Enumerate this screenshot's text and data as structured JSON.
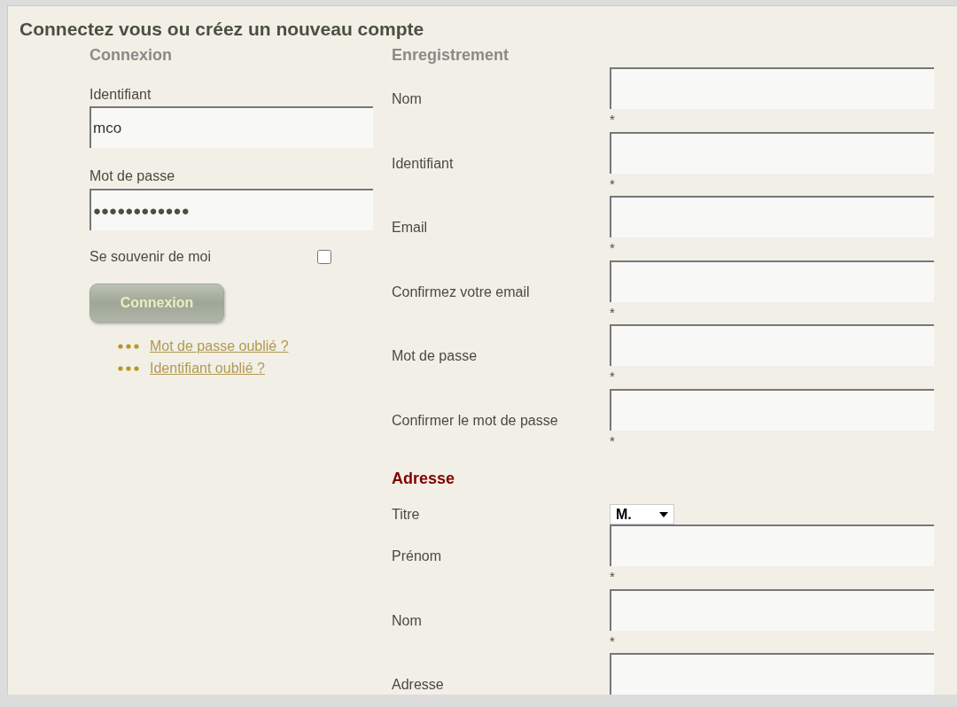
{
  "page": {
    "title": "Connectez vous ou créez un nouveau compte"
  },
  "login": {
    "heading": "Connexion",
    "fields": [
      {
        "label": "Identifiant",
        "value": "mco"
      },
      {
        "label": "Mot de passe",
        "value": "●●●●●●●●●●●●"
      }
    ],
    "remember": {
      "label": "Se souvenir de moi",
      "checked": false
    },
    "button": "Connexion",
    "links": [
      "Mot de passe oublié ?",
      "Identifiant oublié ?"
    ]
  },
  "register": {
    "heading": "Enregistrement",
    "fields": [
      {
        "label": "Nom",
        "required_mark": "*"
      },
      {
        "label": "Identifiant",
        "required_mark": "*"
      },
      {
        "label": "Email",
        "required_mark": "*"
      },
      {
        "label": "Confirmez votre email",
        "required_mark": "*"
      },
      {
        "label": "Mot de passe",
        "required_mark": "*"
      },
      {
        "label": "Confirmer le mot de passe",
        "required_mark": "*"
      }
    ]
  },
  "address": {
    "heading": "Adresse",
    "title_select": {
      "label": "Titre",
      "value": "M."
    },
    "fields": [
      {
        "label": "Prénom",
        "required_mark": "*"
      },
      {
        "label": "Nom",
        "required_mark": "*"
      },
      {
        "label": "Adresse"
      }
    ]
  }
}
